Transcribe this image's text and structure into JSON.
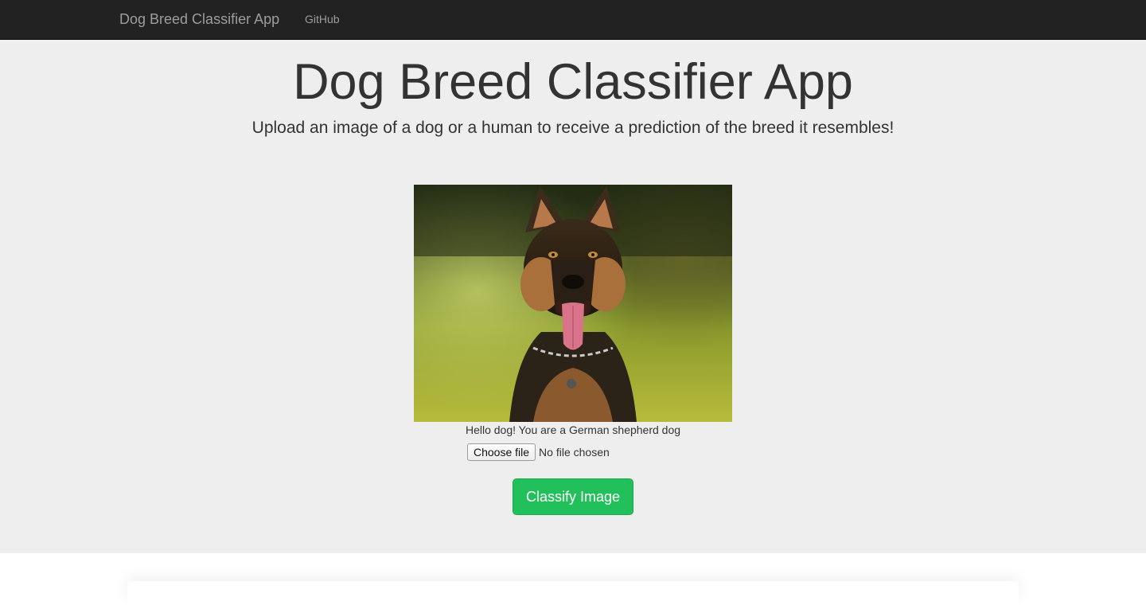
{
  "navbar": {
    "brand": "Dog Breed Classifier App",
    "links": [
      {
        "label": "GitHub"
      }
    ]
  },
  "main": {
    "title": "Dog Breed Classifier App",
    "subtitle": "Upload an image of a dog or a human to receive a prediction of the breed it resembles!",
    "prediction": "Hello dog! You are a German shepherd dog",
    "file_button_label": "Choose file",
    "file_status": "No file chosen",
    "submit_label": "Classify Image"
  },
  "colors": {
    "navbar_bg": "#222222",
    "jumbotron_bg": "#eeeeee",
    "submit_bg": "#22c05a"
  }
}
